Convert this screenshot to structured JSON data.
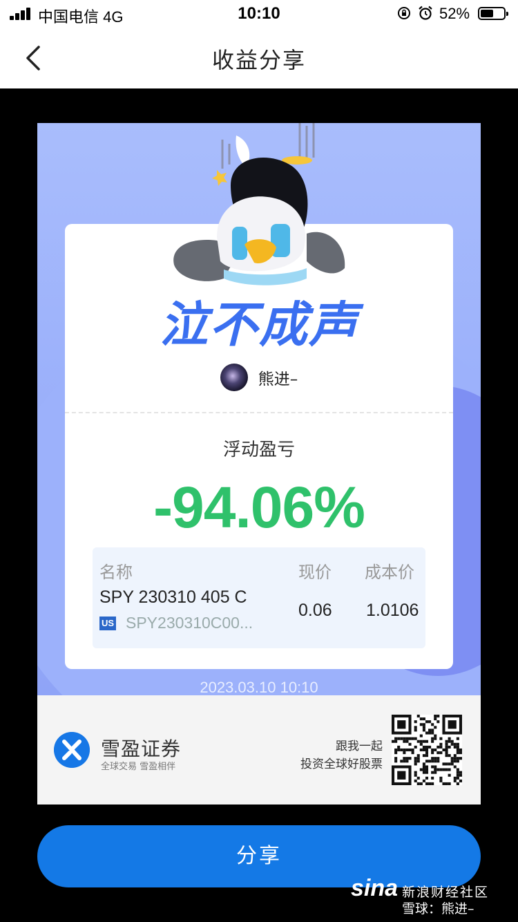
{
  "status_bar": {
    "carrier": "中国电信  4G",
    "time": "10:10",
    "battery_percent": "52%"
  },
  "nav": {
    "back_icon": "chevron-left-icon",
    "title": "收益分享"
  },
  "card": {
    "headline": "泣不成声",
    "username": "熊进–",
    "pl_label": "浮动盈亏",
    "pl_value": "-94.06%",
    "pl_color": "#2fc16b",
    "holding": {
      "col_name": "名称",
      "col_price": "现价",
      "col_cost": "成本价",
      "name": "SPY 230310 405 C",
      "market_badge": "US",
      "code": "SPY230310C00...",
      "price": "0.06",
      "cost": "1.0106"
    },
    "date": "2023.03.10 10:10"
  },
  "footer": {
    "brand_name": "雪盈证券",
    "brand_tagline": "全球交易  雪盈相伴",
    "slogan_line1": "跟我一起",
    "slogan_line2": "投资全球好股票"
  },
  "share_button": "分享",
  "watermark": {
    "logo": "sina",
    "line1": "新浪财经社区",
    "line2": "雪球：熊进–"
  },
  "colors": {
    "accent": "#1479e6",
    "headline": "#3a6ff0",
    "card_bg": "#9db2fb"
  }
}
